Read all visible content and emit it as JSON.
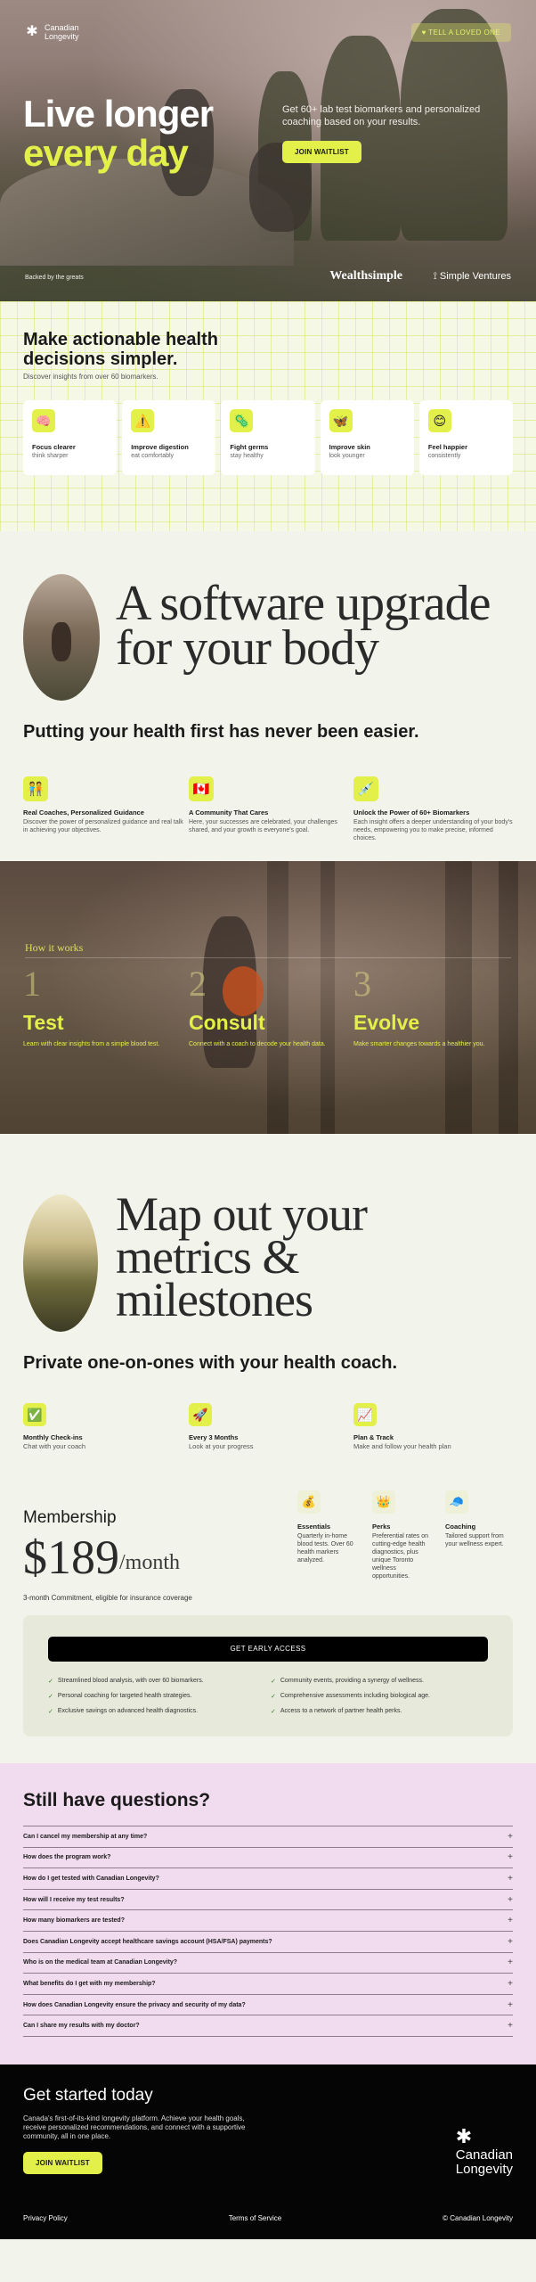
{
  "header": {
    "logo_mark": "✱",
    "logo_line1": "Canadian",
    "logo_line2": "Longevity",
    "tell_label": "♥  TELL A LOVED ONE"
  },
  "hero": {
    "title_line1": "Live longer",
    "title_line2": "every day",
    "subtitle": "Get 60+ lab test biomarkers and personalized coaching based on your results.",
    "join_label": "JOIN WAITLIST",
    "backed_by": "Backed by the greats",
    "partner1": "Wealthsimple",
    "partner2": "⟟ Simple Ventures"
  },
  "benefits_section": {
    "title": "Make actionable health decisions simpler.",
    "subtitle": "Discover insights from over 60 biomarkers.",
    "items": [
      {
        "icon": "brain-icon",
        "glyph": "🧠",
        "title": "Focus clearer",
        "desc": "think sharper"
      },
      {
        "icon": "warning-icon",
        "glyph": "⚠️",
        "title": "Improve digestion",
        "desc": "eat comfortably"
      },
      {
        "icon": "germ-icon",
        "glyph": "🦠",
        "title": "Fight germs",
        "desc": "stay healthy"
      },
      {
        "icon": "butterfly-icon",
        "glyph": "🦋",
        "title": "Improve skin",
        "desc": "look younger"
      },
      {
        "icon": "smile-icon",
        "glyph": "😊",
        "title": "Feel happier",
        "desc": "consistently"
      }
    ]
  },
  "software": {
    "headline_line1": "A software upgrade",
    "headline_line2": "for your body",
    "subhead": "Putting your health first has never been easier.",
    "features": [
      {
        "icon": "coach-icon",
        "glyph": "🧑‍🤝‍🧑",
        "title": "Real Coaches, Personalized Guidance",
        "desc": "Discover the power of personalized guidance and real talk in achieving your objectives."
      },
      {
        "icon": "canada-flag-icon",
        "glyph": "🇨🇦",
        "title": "A Community That Cares",
        "desc": "Here, your successes are celebrated, your challenges shared, and your growth is everyone's goal."
      },
      {
        "icon": "syringe-icon",
        "glyph": "💉",
        "title": "Unlock the Power of 60+ Biomarkers",
        "desc": "Each insight offers a deeper understanding of your body's needs, empowering you to make precise, informed choices."
      }
    ]
  },
  "how_it_works": {
    "label": "How it works",
    "steps": [
      {
        "num": "1",
        "title": "Test",
        "desc": "Learn with clear insights from a simple blood test."
      },
      {
        "num": "2",
        "title": "Consult",
        "desc": "Connect with a coach to decode your health data."
      },
      {
        "num": "3",
        "title": "Evolve",
        "desc": "Make smarter changes towards a healthier you."
      }
    ]
  },
  "map_section": {
    "headline_line1": "Map out your",
    "headline_line2": "metrics &",
    "headline_line3": "milestones",
    "subhead": "Private one-on-ones with your health coach.",
    "steps": [
      {
        "icon": "check-box-icon",
        "glyph": "✅",
        "title": "Monthly Check-ins",
        "desc": "Chat with your coach"
      },
      {
        "icon": "rocket-icon",
        "glyph": "🚀",
        "title": "Every 3 Months",
        "desc": "Look at your progress"
      },
      {
        "icon": "chart-icon",
        "glyph": "📈",
        "title": "Plan & Track",
        "desc": "Make and follow your health plan"
      }
    ]
  },
  "membership": {
    "title": "Membership",
    "price": "$189",
    "per": "/month",
    "commitment": "3-month Commitment, eligible for insurance coverage",
    "perks": [
      {
        "icon": "money-bag-icon",
        "glyph": "💰",
        "title": "Essentials",
        "desc": "Quarterly in-home blood tests. Over 60 health markers analyzed."
      },
      {
        "icon": "crown-icon",
        "glyph": "👑",
        "title": "Perks",
        "desc": "Preferential rates on cutting-edge health diagnostics, plus unique Toronto wellness opportunities."
      },
      {
        "icon": "cap-icon",
        "glyph": "🧢",
        "title": "Coaching",
        "desc": "Tailored support from your wellness expert."
      }
    ],
    "cta": "GET EARLY ACCESS",
    "list_left": [
      "Streamlined blood analysis, with over 60 biomarkers.",
      "Personal coaching for targeted health strategies.",
      "Exclusive savings on advanced health diagnostics."
    ],
    "list_right": [
      "Community events, providing a synergy of wellness.",
      "Comprehensive assessments including biological age.",
      "Access to a network of partner health perks."
    ]
  },
  "faq": {
    "title": "Still have questions?",
    "questions": [
      "Can I cancel my membership at any time?",
      "How does the program work?",
      "How do I get tested with Canadian Longevity?",
      "How will I receive my test results?",
      "How many biomarkers are tested?",
      "Does Canadian Longevity accept healthcare savings account (HSA/FSA) payments?",
      "Who is on the medical team at Canadian Longevity?",
      "What benefits do I get with my membership?",
      "How does Canadian Longevity ensure the privacy and security of my data?",
      "Can I share my results with my doctor?"
    ],
    "plus": "+"
  },
  "footer": {
    "title": "Get started today",
    "desc": "Canada's first-of-its-kind longevity platform. Achieve your health goals, receive personalized recommendations, and connect with a supportive community, all in one place.",
    "join_label": "JOIN WAITLIST",
    "logo_mark": "✱",
    "logo_line1": "Canadian",
    "logo_line2": "Longevity",
    "privacy": "Privacy Policy",
    "terms": "Terms of Service",
    "copyright": "© Canadian Longevity"
  },
  "colors": {
    "accent": "#e3f04a",
    "faq_bg": "#f1dbef",
    "page_bg": "#f2f3ea"
  }
}
